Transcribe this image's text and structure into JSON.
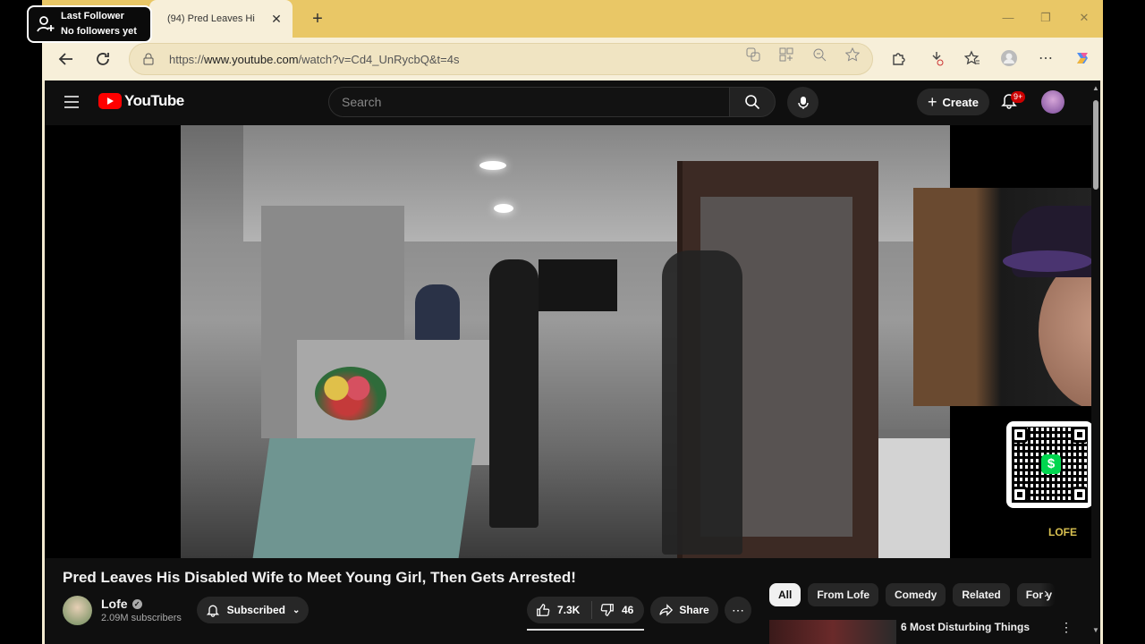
{
  "browser": {
    "tab_title": "(94) Pred Leaves Hi",
    "tab_prefix": ")",
    "url_prefix": "https://",
    "url_host": "www.youtube.com",
    "url_path": "/watch?v=Cd4_UnRycbQ&t=4s"
  },
  "overlay": {
    "line1": "Last Follower",
    "line2": "No followers yet"
  },
  "youtube": {
    "logo_text": "YouTube",
    "search_placeholder": "Search",
    "create_label": "Create",
    "notif_badge": "9+"
  },
  "video": {
    "title": "Pred Leaves His Disabled Wife to Meet Young Girl, Then Gets Arrested!",
    "watermark": "LOFE"
  },
  "channel": {
    "name": "Lofe",
    "subscribers": "2.09M subscribers",
    "subscribe_label": "Subscribed"
  },
  "actions": {
    "likes": "7.3K",
    "dislikes": "46",
    "share_label": "Share"
  },
  "chips": [
    "All",
    "From Lofe",
    "Comedy",
    "Related",
    "For y"
  ],
  "recommendation": {
    "title": "6 Most Disturbing Things"
  },
  "colors": {
    "youtube_red": "#ff0000",
    "cashapp_green": "#00d64f",
    "tabstrip": "#e9c766"
  }
}
